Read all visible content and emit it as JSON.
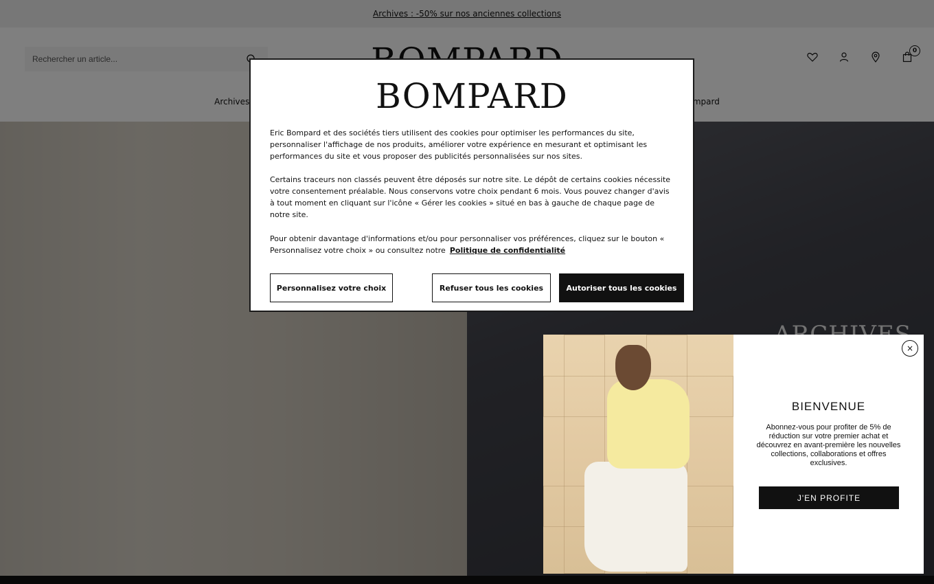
{
  "announcement": {
    "text": "Archives : -50% sur nos anciennes collections"
  },
  "header": {
    "search_placeholder": "Rechercher un article...",
    "logo": "BOMPARD",
    "cart_count": "0",
    "icons": [
      "heart-icon",
      "user-icon",
      "location-pin-icon",
      "bag-icon"
    ]
  },
  "nav": {
    "items": [
      "Archives",
      "",
      "",
      "",
      "",
      "Bompard"
    ]
  },
  "hero": {
    "title": "ARCHIVES"
  },
  "cookie": {
    "logo": "BOMPARD",
    "p1": "Eric Bompard et des sociétés tiers utilisent des cookies pour optimiser les performances du site, personnaliser l'affichage de nos produits, améliorer votre expérience en mesurant et optimisant les performances du site et vous proposer des publicités personnalisées sur nos sites.",
    "p2": "Certains traceurs non classés peuvent être déposés sur notre site. Le dépôt de certains cookies nécessite votre consentement préalable. Nous conservons votre choix pendant 6 mois. Vous pouvez changer d'avis à tout moment en cliquant sur l'icône « Gérer les cookies » situé en bas à gauche de chaque page de notre site.",
    "p3": "Pour obtenir davantage d'informations et/ou pour personnaliser vos préférences, cliquez sur le bouton « Personnalisez votre choix » ou consultez notre",
    "privacy_link": "Politique de confidentialité",
    "btn_customize": "Personnalisez votre choix",
    "btn_refuse": "Refuser tous les cookies",
    "btn_accept": "Autoriser tous les cookies"
  },
  "promo": {
    "close": "×",
    "title": "BIENVENUE",
    "text": "Abonnez-vous pour profiter de 5% de réduction sur votre premier achat et découvrez en avant-première les nouvelles collections, collaborations et offres exclusives.",
    "button": "J'EN PROFITE"
  }
}
